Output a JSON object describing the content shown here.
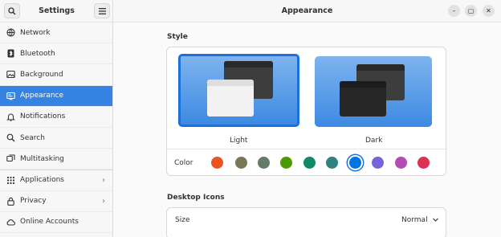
{
  "sidebar": {
    "title": "Settings",
    "items": [
      {
        "label": "Network",
        "icon": "network-icon"
      },
      {
        "label": "Bluetooth",
        "icon": "bluetooth-icon"
      },
      {
        "label": "Background",
        "icon": "background-icon"
      },
      {
        "label": "Appearance",
        "icon": "appearance-icon",
        "active": true
      },
      {
        "label": "Notifications",
        "icon": "bell-icon"
      },
      {
        "label": "Search",
        "icon": "search-icon"
      },
      {
        "label": "Multitasking",
        "icon": "multitasking-icon"
      },
      {
        "label": "Applications",
        "icon": "apps-icon",
        "chevron": true
      },
      {
        "label": "Privacy",
        "icon": "lock-icon",
        "chevron": true
      },
      {
        "label": "Online Accounts",
        "icon": "cloud-icon"
      }
    ]
  },
  "header": {
    "title": "Appearance"
  },
  "style": {
    "title": "Style",
    "themes": [
      {
        "label": "Light",
        "selected": true
      },
      {
        "label": "Dark",
        "selected": false
      }
    ],
    "color_label": "Color",
    "colors": [
      "#e95420",
      "#787859",
      "#657b69",
      "#4e9a06",
      "#0e8a68",
      "#308280",
      "#0073e5",
      "#7764d8",
      "#b34cb3",
      "#da3450"
    ],
    "selected_color_index": 6
  },
  "desktop_icons": {
    "title": "Desktop Icons",
    "size_label": "Size",
    "size_value": "Normal"
  },
  "accent": "#3584e4"
}
